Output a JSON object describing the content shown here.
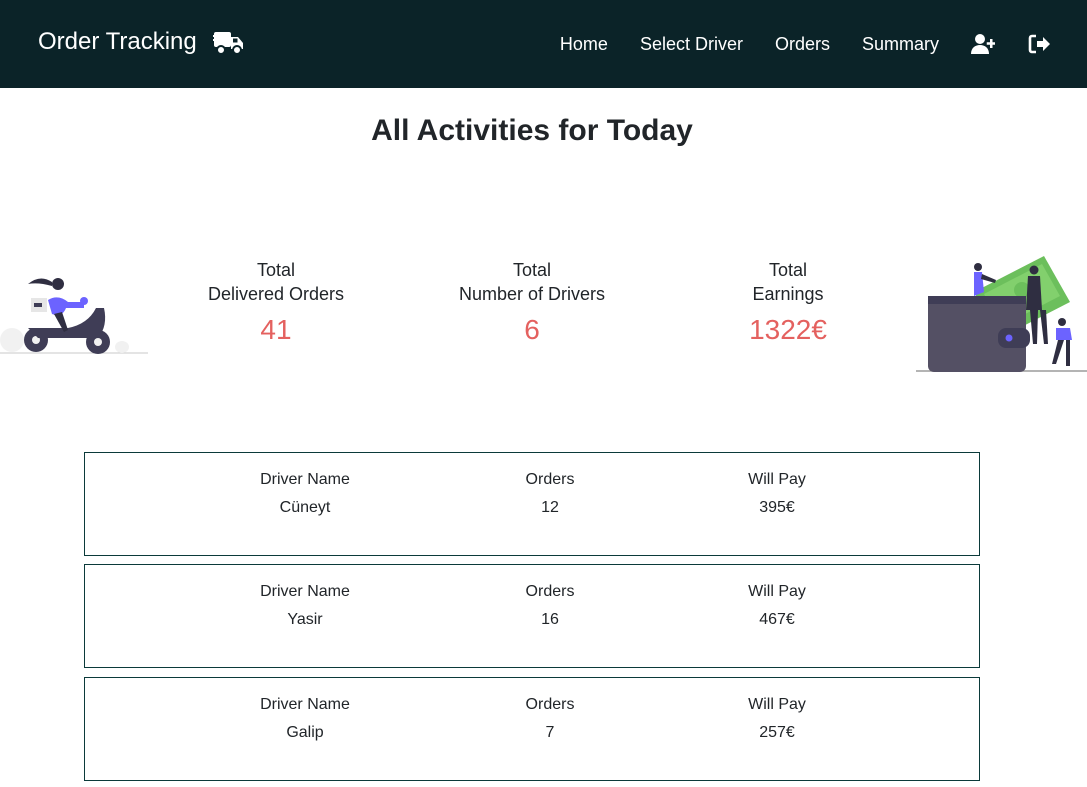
{
  "header": {
    "brand": "Order Tracking",
    "brand_icon": "shipping-truck-icon",
    "nav": [
      {
        "label": "Home"
      },
      {
        "label": "Select Driver"
      },
      {
        "label": "Orders"
      },
      {
        "label": "Summary"
      }
    ],
    "icons": [
      "add-user-icon",
      "logout-icon"
    ]
  },
  "main": {
    "title": "All Activities for Today",
    "stats": [
      {
        "label_line1": "Total",
        "label_line2": "Delivered Orders",
        "value": "41"
      },
      {
        "label_line1": "Total",
        "label_line2": "Number of Drivers",
        "value": "6"
      },
      {
        "label_line1": "Total",
        "label_line2": "Earnings",
        "value": "1322€"
      }
    ],
    "columns": {
      "name": "Driver Name",
      "orders": "Orders",
      "pay": "Will Pay"
    },
    "drivers": [
      {
        "name": "Cüneyt",
        "orders": "12",
        "pay": "395€"
      },
      {
        "name": "Yasir",
        "orders": "16",
        "pay": "467€"
      },
      {
        "name": "Galip",
        "orders": "7",
        "pay": "257€"
      }
    ]
  },
  "colors": {
    "navbar": "#0b2328",
    "accent": "#e4615f",
    "card_border": "#0b3a3a",
    "illustration": "#6c63ff"
  }
}
